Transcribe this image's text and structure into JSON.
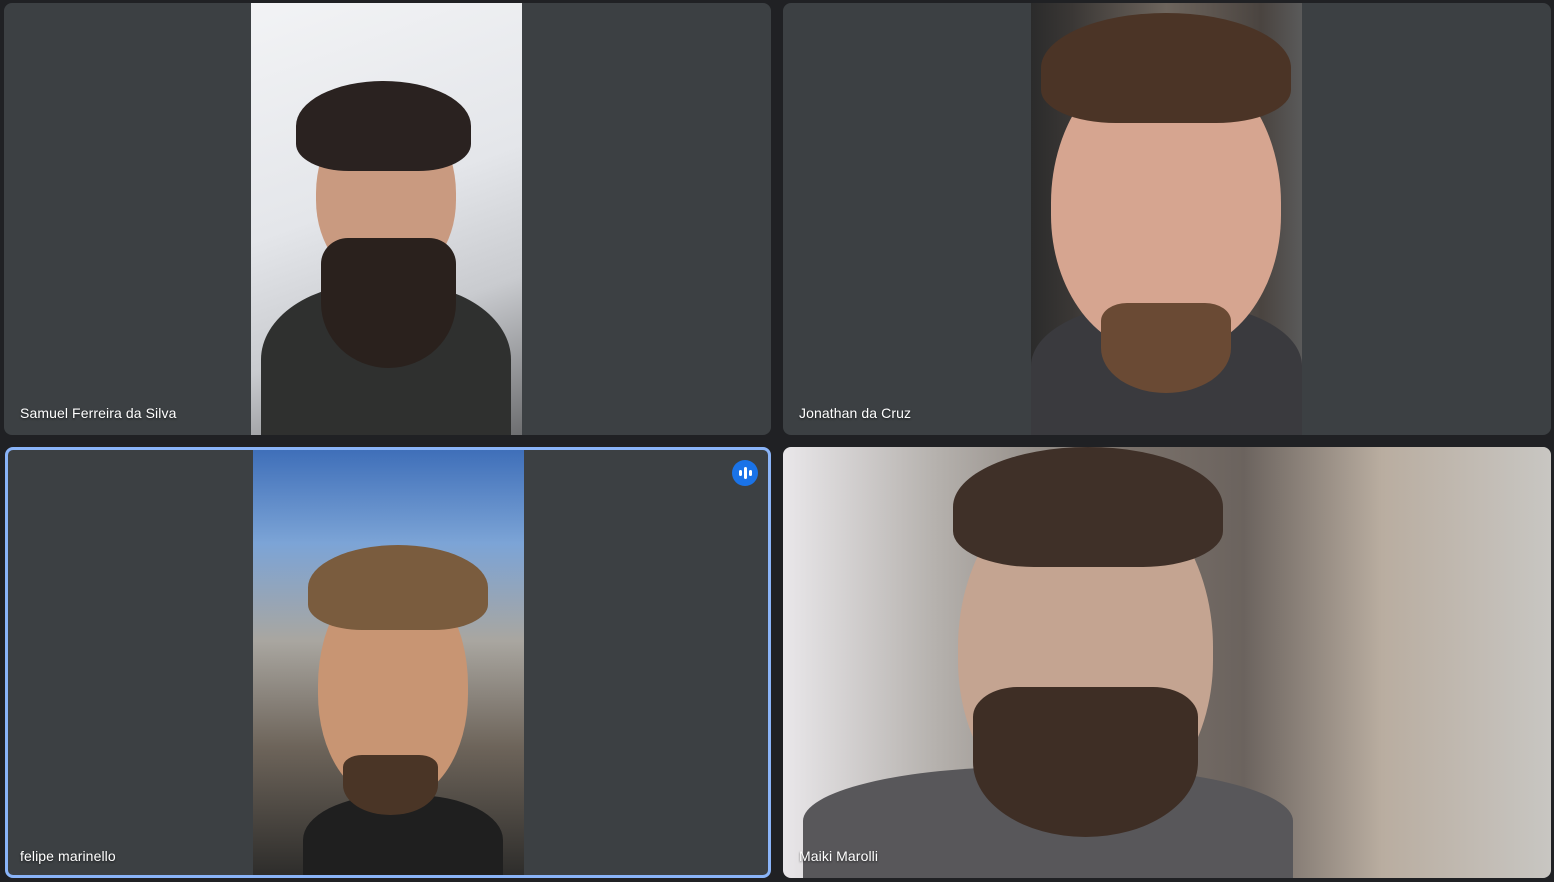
{
  "participants": [
    {
      "name": "Samuel Ferreira da Silva",
      "speaking": false
    },
    {
      "name": "Jonathan da Cruz",
      "speaking": false
    },
    {
      "name": "felipe marinello",
      "speaking": true
    },
    {
      "name": "Maiki Marolli",
      "speaking": false
    }
  ],
  "colors": {
    "tile_background": "#3c4043",
    "page_background": "#202124",
    "active_speaker_border": "#8ab4f8",
    "speaking_indicator": "#1a73e8"
  },
  "icons": {
    "speaking_indicator": "audio-level-icon"
  }
}
